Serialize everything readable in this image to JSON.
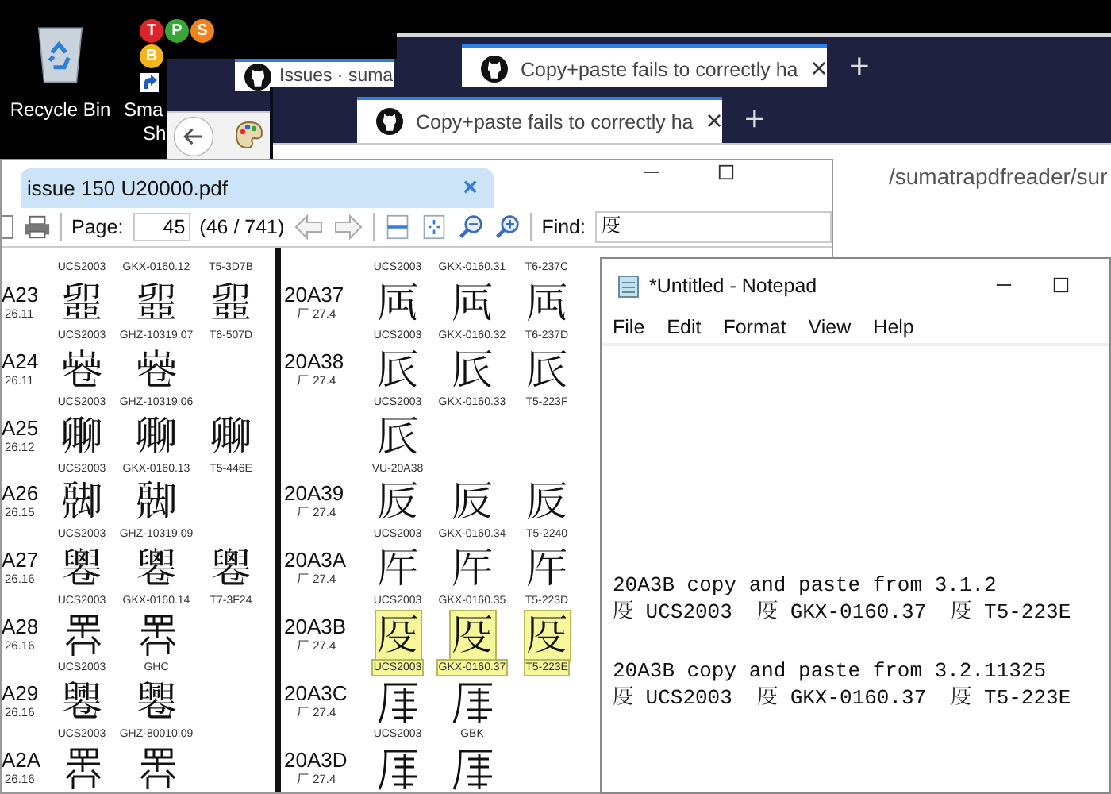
{
  "desktop_icons": [
    {
      "kind": "recycle-bin",
      "label_lines": [
        "Recycle Bin"
      ]
    },
    {
      "kind": "app-group",
      "label_lines": [
        "Sma",
        "Sh"
      ],
      "badges": [
        {
          "letter": "T",
          "color": "#d8262c"
        },
        {
          "letter": "P",
          "color": "#3aa536"
        },
        {
          "letter": "S",
          "color": "#f0831e"
        },
        {
          "letter": "B",
          "color": "#f2b51c"
        }
      ]
    }
  ],
  "browser_windows": [
    {
      "tab_title": "Issues · suma"
    },
    {
      "tab_title": "Copy+paste fails to correctly ha",
      "close": "×",
      "new_tab": "+"
    },
    {
      "tab_title": "Copy+paste fails to correctly ha",
      "close": "×",
      "new_tab": "+",
      "address": "/sumatrapdfreader/sur"
    }
  ],
  "pdf_viewer": {
    "tab": {
      "title": "issue 150 U20000.pdf",
      "close": "×"
    },
    "toolbar": {
      "page_label": "Page:",
      "page": "45",
      "page_info": "(46 / 741)",
      "find_label": "Find:",
      "find_value": "𠨻"
    },
    "columns": [
      {
        "entries": [
          {
            "glyphs": [
              {
                "kind": "label",
                "source": "UCS2003",
                "highlighted": false
              },
              {
                "kind": "label",
                "source": "GKX-0160.12",
                "highlighted": false
              },
              {
                "kind": "label",
                "source": "T5-3D7B",
                "highlighted": false
              }
            ]
          },
          {
            "code": "A23",
            "stroke": "26.11",
            "glyphs": [
              {
                "kind": "char",
                "char": "𠨣",
                "source": "UCS2003",
                "highlighted": false
              },
              {
                "kind": "char",
                "char": "𠨣",
                "source": "GHZ-10319.07",
                "highlighted": false
              },
              {
                "kind": "char",
                "char": "𠨣",
                "source": "T6-507D",
                "highlighted": false
              }
            ]
          },
          {
            "code": "A24",
            "stroke": "26.11",
            "glyphs": [
              {
                "kind": "char",
                "char": "𠨤",
                "source": "UCS2003",
                "highlighted": false
              },
              {
                "kind": "char",
                "char": "𠨤",
                "source": "GHZ-10319.06",
                "highlighted": false
              }
            ]
          },
          {
            "code": "A25",
            "stroke": "26.12",
            "glyphs": [
              {
                "kind": "char",
                "char": "𠨥",
                "source": "UCS2003",
                "highlighted": false
              },
              {
                "kind": "char",
                "char": "𠨥",
                "source": "GKX-0160.13",
                "highlighted": false
              },
              {
                "kind": "char",
                "char": "𠨥",
                "source": "T5-446E",
                "highlighted": false
              }
            ]
          },
          {
            "code": "A26",
            "stroke": "26.15",
            "glyphs": [
              {
                "kind": "char",
                "char": "𠨦",
                "source": "UCS2003",
                "highlighted": false
              },
              {
                "kind": "char",
                "char": "𠨦",
                "source": "GHZ-10319.09",
                "highlighted": false
              }
            ]
          },
          {
            "code": "A27",
            "stroke": "26.16",
            "glyphs": [
              {
                "kind": "char",
                "char": "𠨧",
                "source": "UCS2003",
                "highlighted": false
              },
              {
                "kind": "char",
                "char": "𠨧",
                "source": "GKX-0160.14",
                "highlighted": false
              },
              {
                "kind": "char",
                "char": "𠨧",
                "source": "T7-3F24",
                "highlighted": false
              }
            ]
          },
          {
            "code": "A28",
            "stroke": "26.16",
            "glyphs": [
              {
                "kind": "drawing",
                "source": "UCS2003",
                "highlighted": false
              },
              {
                "kind": "drawing",
                "source": "GHC",
                "highlighted": false
              }
            ]
          },
          {
            "code": "A29",
            "stroke": "26.16",
            "glyphs": [
              {
                "kind": "char",
                "char": "𠨩",
                "source": "UCS2003",
                "highlighted": false
              },
              {
                "kind": "char",
                "char": "𠨩",
                "source": "GHZ-80010.09",
                "highlighted": false
              }
            ]
          },
          {
            "code": "A2A",
            "stroke": "26.16",
            "glyphs": [
              {
                "kind": "drawing",
                "highlighted": false
              },
              {
                "kind": "drawing",
                "highlighted": false
              }
            ]
          }
        ]
      },
      {
        "entries": [
          {
            "glyphs": [
              {
                "kind": "label",
                "source": "UCS2003",
                "highlighted": false
              },
              {
                "kind": "label",
                "source": "GKX-0160.31",
                "highlighted": false
              },
              {
                "kind": "label",
                "source": "T6-237C",
                "highlighted": false
              }
            ]
          },
          {
            "code": "20A37",
            "stroke": "厂 27.4",
            "glyphs": [
              {
                "kind": "char",
                "char": "𠨷",
                "source": "UCS2003",
                "highlighted": false
              },
              {
                "kind": "char",
                "char": "𠨷",
                "source": "GKX-0160.32",
                "highlighted": false
              },
              {
                "kind": "char",
                "char": "𠨷",
                "source": "T6-237D",
                "highlighted": false
              }
            ]
          },
          {
            "code": "20A38",
            "stroke": "厂 27.4",
            "glyphs": [
              {
                "kind": "char",
                "char": "𠨸",
                "source": "UCS2003",
                "highlighted": false
              },
              {
                "kind": "char",
                "char": "𠨸",
                "source": "GKX-0160.33",
                "highlighted": false
              },
              {
                "kind": "char",
                "char": "𠨸",
                "source": "T5-223F",
                "highlighted": false
              }
            ]
          },
          {
            "glyphs": [
              {
                "kind": "char",
                "char": "𠨸",
                "source": "VU-20A38",
                "highlighted": false
              }
            ]
          },
          {
            "code": "20A39",
            "stroke": "厂 27.4",
            "glyphs": [
              {
                "kind": "char",
                "char": "𠨹",
                "source": "UCS2003",
                "highlighted": false
              },
              {
                "kind": "char",
                "char": "𠨹",
                "source": "GKX-0160.34",
                "highlighted": false
              },
              {
                "kind": "char",
                "char": "𠨹",
                "source": "T5-2240",
                "highlighted": false
              }
            ]
          },
          {
            "code": "20A3A",
            "stroke": "厂 27.4",
            "glyphs": [
              {
                "kind": "char",
                "char": "𠨺",
                "source": "UCS2003",
                "highlighted": false
              },
              {
                "kind": "char",
                "char": "𠨺",
                "source": "GKX-0160.35",
                "highlighted": false
              },
              {
                "kind": "char",
                "char": "𠨺",
                "source": "T5-223D",
                "highlighted": false
              }
            ]
          },
          {
            "code": "20A3B",
            "stroke": "厂 27.4",
            "glyphs": [
              {
                "kind": "char",
                "char": "𠨻",
                "source": "UCS2003",
                "highlighted": true
              },
              {
                "kind": "char",
                "char": "𠨻",
                "source": "GKX-0160.37",
                "highlighted": true
              },
              {
                "kind": "char",
                "char": "𠨻",
                "source": "T5-223E",
                "highlighted": true
              }
            ]
          },
          {
            "code": "20A3C",
            "stroke": "厂 27.4",
            "glyphs": [
              {
                "kind": "drawing",
                "source": "UCS2003",
                "highlighted": false
              },
              {
                "kind": "drawing",
                "source": "GBK",
                "highlighted": false
              }
            ]
          },
          {
            "code": "20A3D",
            "stroke": "厂 27.4",
            "glyphs": [
              {
                "kind": "drawing",
                "highlighted": false
              },
              {
                "kind": "drawing",
                "highlighted": false
              }
            ]
          }
        ]
      }
    ]
  },
  "notepad": {
    "title": "*Untitled - Notepad",
    "menu": [
      "File",
      "Edit",
      "Format",
      "View",
      "Help"
    ],
    "paragraphs": [
      [
        "20A3B copy and paste from 3.1.2",
        "𠨻 UCS2003  𠨻 GKX-0160.37  𠨻 T5-223E"
      ],
      [
        "20A3B copy and paste from 3.2.11325",
        "𠨻 UCS2003  𠨻 GKX-0160.37  𠨻 T5-223E"
      ]
    ]
  }
}
